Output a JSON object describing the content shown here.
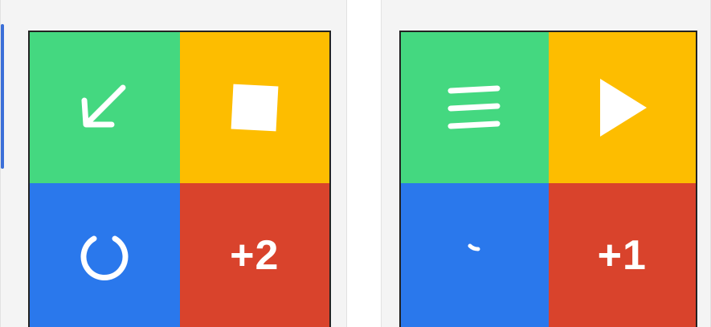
{
  "colors": {
    "green": "#44d880",
    "yellow": "#fdbd00",
    "blue": "#2a78ec",
    "red": "#d9432c"
  },
  "screens": [
    {
      "tiles": [
        {
          "color": "green",
          "icon": "arrow-down-left-icon"
        },
        {
          "color": "yellow",
          "icon": "stop-square-icon"
        },
        {
          "color": "blue",
          "icon": "loading-ring-icon"
        },
        {
          "color": "red",
          "label": "+2"
        }
      ]
    },
    {
      "tiles": [
        {
          "color": "green",
          "icon": "menu-lines-icon"
        },
        {
          "color": "yellow",
          "icon": "play-icon"
        },
        {
          "color": "blue",
          "icon": "loading-tick-icon"
        },
        {
          "color": "red",
          "label": "+1"
        }
      ]
    }
  ]
}
